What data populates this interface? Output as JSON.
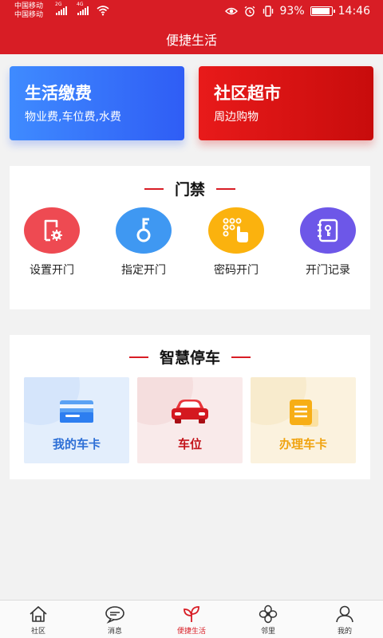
{
  "status_bar": {
    "carrier1": "中国移动",
    "carrier2": "中国移动",
    "net1": "2G",
    "net2": "4G",
    "battery": "93%",
    "battery_level": 0.93,
    "time": "14:46"
  },
  "header": {
    "title": "便捷生活"
  },
  "cards": [
    {
      "title": "生活缴费",
      "subtitle": "物业费,车位费,水费",
      "color": "#2f5df5"
    },
    {
      "title": "社区超市",
      "subtitle": "周边购物",
      "color": "#d81d25"
    }
  ],
  "access": {
    "title": "门禁",
    "items": [
      {
        "label": "设置开门",
        "icon": "door-settings-icon",
        "color": "#ee4a52"
      },
      {
        "label": "指定开门",
        "icon": "key-icon",
        "color": "#3f98f2"
      },
      {
        "label": "密码开门",
        "icon": "keypad-icon",
        "color": "#fbb20e"
      },
      {
        "label": "开门记录",
        "icon": "record-book-icon",
        "color": "#6d57e8"
      }
    ]
  },
  "parking": {
    "title": "智慧停车",
    "items": [
      {
        "label": "我的车卡",
        "icon": "card-icon",
        "color": "#2d6fd6",
        "bg": "#e3eefc"
      },
      {
        "label": "车位",
        "icon": "car-icon",
        "color": "#c3131a",
        "bg": "#f9eaea"
      },
      {
        "label": "办理车卡",
        "icon": "document-icon",
        "color": "#f0a30f",
        "bg": "#fbf2de"
      }
    ]
  },
  "bottom_nav": {
    "items": [
      {
        "label": "社区",
        "icon": "home-icon"
      },
      {
        "label": "消息",
        "icon": "message-icon"
      },
      {
        "label": "便捷生活",
        "icon": "sprout-icon",
        "active": true
      },
      {
        "label": "邻里",
        "icon": "clover-icon"
      },
      {
        "label": "我的",
        "icon": "user-icon"
      }
    ]
  }
}
